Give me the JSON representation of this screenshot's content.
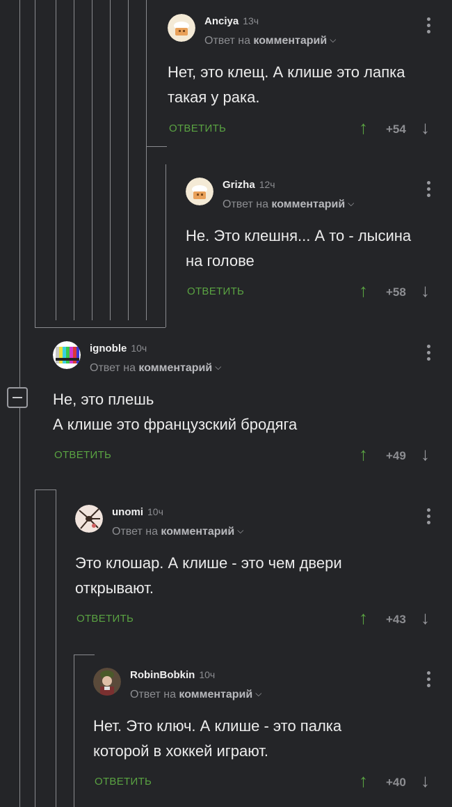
{
  "comments": [
    {
      "author": "Anciya",
      "time": "13ч",
      "reply_prefix": "Ответ на",
      "reply_link": "комментарий",
      "text_lines": [
        "Нет, это клещ. А клише это лапка",
        "такая у рака."
      ],
      "reply_label": "ОТВЕТИТЬ",
      "rating": "+54"
    },
    {
      "author": "Grizha",
      "time": "12ч",
      "reply_prefix": "Ответ на",
      "reply_link": "комментарий",
      "text_lines": [
        "Не. Это клешня... А то - лысина",
        "на голове"
      ],
      "reply_label": "ОТВЕТИТЬ",
      "rating": "+58"
    },
    {
      "author": "ignoble",
      "time": "10ч",
      "reply_prefix": "Ответ на",
      "reply_link": "комментарий",
      "text_lines": [
        "Не, это плешь",
        "А клише это французский бродяга"
      ],
      "reply_label": "ОТВЕТИТЬ",
      "rating": "+49"
    },
    {
      "author": "unomi",
      "time": "10ч",
      "reply_prefix": "Ответ на",
      "reply_link": "комментарий",
      "text_lines": [
        "Это клошар. А клише - это чем двери",
        "открывают."
      ],
      "reply_label": "ОТВЕТИТЬ",
      "rating": "+43"
    },
    {
      "author": "RobinBobkin",
      "time": "10ч",
      "reply_prefix": "Ответ на",
      "reply_link": "комментарий",
      "text_lines": [
        "Нет. Это ключ. А клише - это палка",
        "которой в хоккей играют."
      ],
      "reply_label": "ОТВЕТИТЬ",
      "rating": "+40"
    }
  ],
  "colors": {
    "background": "#242528",
    "accent_green": "#5aa342",
    "muted": "#8d8e92"
  },
  "icons": {
    "upvote": "arrow-up-icon",
    "downvote": "arrow-down-icon",
    "menu": "kebab-menu-icon",
    "expand": "chevron-down-icon",
    "collapse": "collapse-minus-icon"
  }
}
